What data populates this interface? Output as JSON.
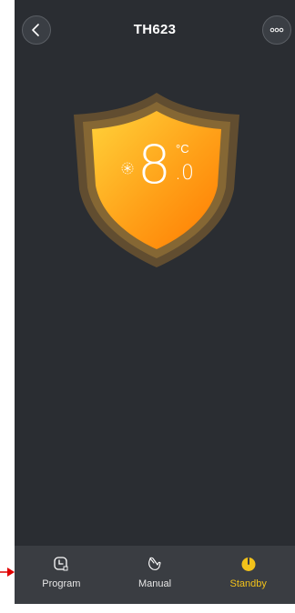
{
  "header": {
    "title": "TH623",
    "back_icon": "chevron-left-icon",
    "more_icon": "more-dots-icon"
  },
  "thermostat": {
    "temp_integer": "8",
    "temp_decimal": ".0",
    "unit": "°C",
    "mode_icon": "snowflake-icon"
  },
  "tabs": [
    {
      "label": "Program",
      "icon": "clock-calendar-icon",
      "active": false
    },
    {
      "label": "Manual",
      "icon": "hand-pointer-icon",
      "active": false
    },
    {
      "label": "Standby",
      "icon": "power-icon",
      "active": true
    }
  ],
  "colors": {
    "background": "#2a2d32",
    "tabbar": "#3a3d42",
    "accent": "#f2c21a",
    "shield_orange": "#ff8c00",
    "shield_yellow": "#ffc830",
    "annotation_arrow": "#e00000"
  }
}
